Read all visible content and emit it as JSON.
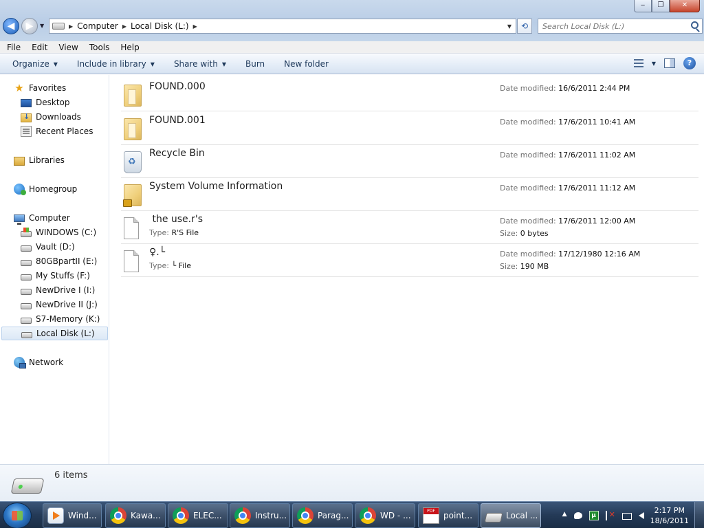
{
  "window": {
    "controls": [
      "minimize",
      "maximize",
      "close"
    ],
    "address": {
      "crumbs": [
        "Computer",
        "Local Disk (L:)"
      ]
    },
    "search": {
      "placeholder": "Search Local Disk (L:)"
    }
  },
  "menubar": [
    "File",
    "Edit",
    "View",
    "Tools",
    "Help"
  ],
  "toolbar": {
    "organize": "Organize",
    "include_in_library": "Include in library",
    "share_with": "Share with",
    "burn": "Burn",
    "new_folder": "New folder"
  },
  "sidebar": {
    "favorites": "Favorites",
    "favorites_items": [
      "Desktop",
      "Downloads",
      "Recent Places"
    ],
    "libraries": "Libraries",
    "homegroup": "Homegroup",
    "computer": "Computer",
    "drives": [
      "WINDOWS (C:)",
      "Vault (D:)",
      "80GBpartII (E:)",
      "My Stuffs (F:)",
      "NewDrive I (I:)",
      "NewDrive II (J:)",
      "S7-Memory (K:)",
      "Local Disk (L:)"
    ],
    "selected": "Local Disk (L:)",
    "network": "Network"
  },
  "labels": {
    "date_modified": "Date modified:",
    "type": "Type:",
    "size": "Size:"
  },
  "items": [
    {
      "name": "FOUND.000",
      "icon": "folder-icon",
      "date": "16/6/2011 2:44 PM"
    },
    {
      "name": "FOUND.001",
      "icon": "folder-icon",
      "date": "17/6/2011 10:41 AM"
    },
    {
      "name": "Recycle Bin",
      "icon": "recycle-bin-icon",
      "date": "17/6/2011 11:02 AM"
    },
    {
      "name": "System Volume Information",
      "icon": "locked-folder-icon",
      "date": "17/6/2011 11:12 AM"
    },
    {
      "name": " the use.r's",
      "icon": "file-icon",
      "type": "R'S File",
      "date": "17/6/2011 12:00 AM",
      "size": "0 bytes"
    },
    {
      "name": "♀.└",
      "icon": "file-icon",
      "type": "└ File",
      "date": "17/12/1980 12:16 AM",
      "size": "190 MB"
    }
  ],
  "details": {
    "count": "6 items"
  },
  "taskbar": {
    "buttons": [
      "Wind...",
      "Kawa...",
      "ELEC...",
      "Instru...",
      "Parag...",
      "WD - ...",
      "point...",
      "Local ..."
    ],
    "clock_time": "2:17 PM",
    "clock_date": "18/6/2011"
  }
}
